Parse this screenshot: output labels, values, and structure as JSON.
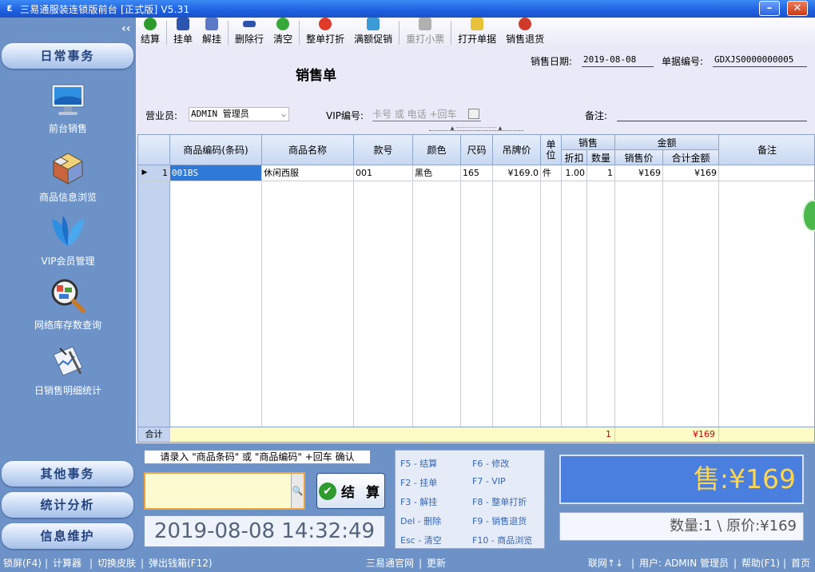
{
  "window": {
    "title": "三易通服装连锁版前台 [正式版] V5.31"
  },
  "sidebar": {
    "collapse_glyph": "‹‹",
    "header_top": "日常事务",
    "items": [
      {
        "label": "前台销售",
        "icon": "monitor-icon"
      },
      {
        "label": "商品信息浏览",
        "icon": "cubes-icon"
      },
      {
        "label": "VIP会员管理",
        "icon": "butterfly-icon"
      },
      {
        "label": "网络库存数查询",
        "icon": "magnifier-map-icon"
      },
      {
        "label": "日销售明细统计",
        "icon": "chart-pen-icon"
      }
    ],
    "bottom_sections": [
      "其他事务",
      "统计分析",
      "信息维护"
    ]
  },
  "toolbar": {
    "buttons": [
      {
        "label": "结算",
        "color": "#2e9b2e",
        "disabled": false
      },
      {
        "label": "挂单",
        "color": "#2d55b0",
        "disabled": false
      },
      {
        "label": "解挂",
        "color": "#5a79c7",
        "disabled": false
      },
      {
        "label": "删除行",
        "color": "#2d55b0",
        "disabled": false
      },
      {
        "label": "清空",
        "color": "#39a83a",
        "disabled": false
      },
      {
        "label": "整单打折",
        "color": "#e03a2a",
        "disabled": false
      },
      {
        "label": "满额促销",
        "color": "#3a9bd6",
        "disabled": false
      },
      {
        "label": "重打小票",
        "color": "#9a9a9a",
        "disabled": true
      },
      {
        "label": "打开单据",
        "color": "#e8c33a",
        "disabled": false
      },
      {
        "label": "销售退货",
        "color": "#d03a2a",
        "disabled": false
      }
    ]
  },
  "form": {
    "doc_title": "销售单",
    "date_label": "销售日期:",
    "date_value": "2019-08-08",
    "docno_label": "单据编号:",
    "docno_value": "GDXJS0000000005",
    "clerk_label": "营业员:",
    "clerk_value": "ADMIN 管理员",
    "vip_label": "VIP编号:",
    "vip_placeholder": "卡号 或 电话 +回车",
    "remark_label": "备注:",
    "remark_value": ""
  },
  "grid": {
    "headers": {
      "code": "商品编码(条码)",
      "name": "商品名称",
      "style": "款号",
      "color": "颜色",
      "size": "尺码",
      "tag_price": "吊牌价",
      "unit": "单位",
      "sale_group": "销售",
      "discount": "折扣",
      "qty": "数量",
      "amount_group": "金额",
      "sale_price": "销售价",
      "total": "合计金额",
      "remark": "备注"
    },
    "rows": [
      {
        "marker": "▶",
        "no": "1",
        "code": "001BS",
        "name": "休闲西服",
        "style": "001",
        "color": "黑色",
        "size": "165",
        "tag_price": "¥169.0",
        "unit": "件",
        "discount": "1.00",
        "qty": "1",
        "sale_price": "¥169",
        "total": "¥169",
        "remark": ""
      }
    ],
    "summary": {
      "label": "合计",
      "qty": "1",
      "total": "¥169"
    }
  },
  "bottom": {
    "hint": "请录入 \"商品条码\" 或 \"商品编码\" +回车 确认",
    "search_glyph": "🔍",
    "settle_label": "结 算",
    "clock": "2019-08-08 14:32:49",
    "shortcuts": [
      "F5 - 结算",
      "F6 - 修改",
      "F2 - 挂单",
      "F7 - VIP",
      "F3 - 解挂",
      "F8 - 整单打折",
      "Del - 删除",
      "F9 - 销售退货",
      "Esc - 清空",
      "F10 - 商品浏览"
    ],
    "sale_display": "售:¥169",
    "qty_display": "数量:1 \\ 原价:¥169"
  },
  "statusbar": {
    "lock": "锁屏(F4)",
    "calc": "计算器",
    "skin": "切换皮肤",
    "drawer": "弹出钱箱(F12)",
    "website": "三易通官网",
    "update": "更新",
    "network": "联网↑↓",
    "user": "用户: ADMIN 管理员",
    "help": "帮助(F1)",
    "home": "首页"
  }
}
